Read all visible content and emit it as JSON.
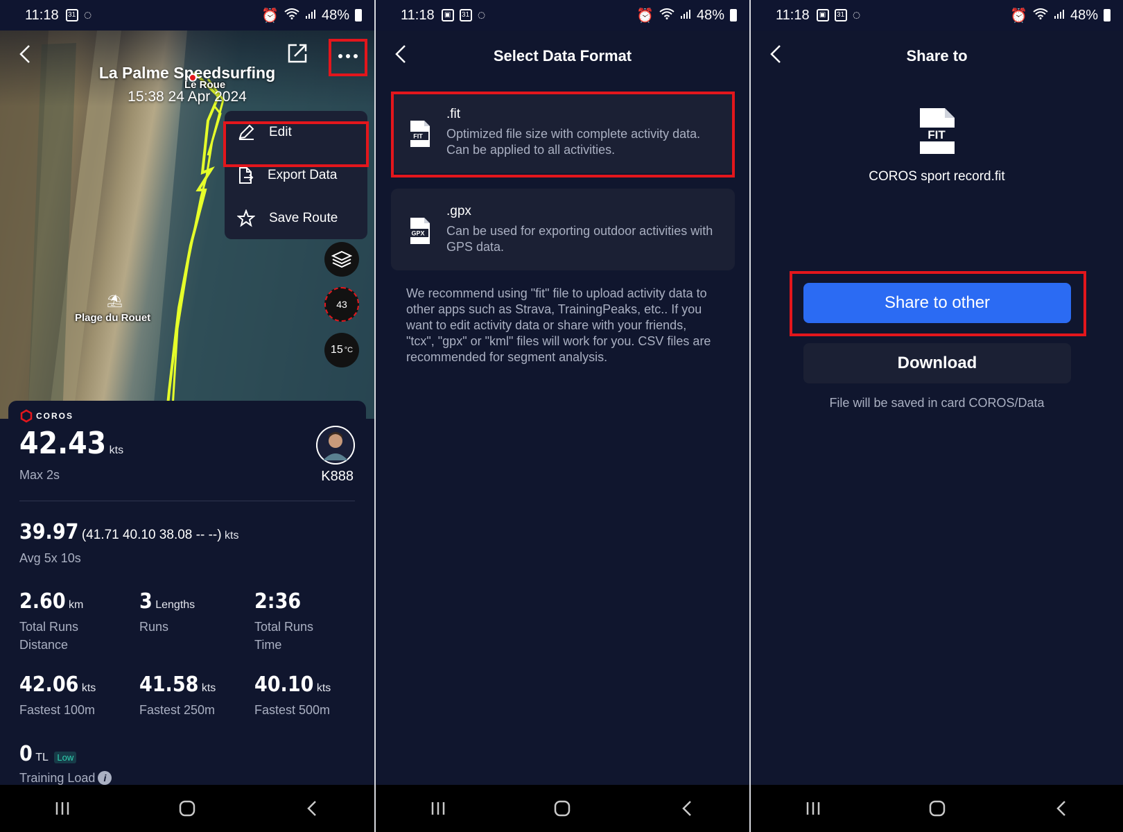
{
  "status_bar": {
    "time": "11:18",
    "battery": "48%"
  },
  "activity_screen": {
    "title": "La Palme Speedsurfing",
    "date": "15:38 24 Apr 2024",
    "map_labels": {
      "place_top": "Le Roue",
      "place_beach": "Plage du Rouet"
    },
    "controls": {
      "view_mode": "2D",
      "compass_value": "43",
      "temperature_value": "15",
      "temperature_unit": "°C"
    },
    "menu": {
      "edit": "Edit",
      "export": "Export Data",
      "save_route": "Save Route"
    },
    "brand": "COROS",
    "max_speed": {
      "value": "42.43",
      "unit": "kts",
      "label": "Max 2s"
    },
    "user": {
      "name": "K888"
    },
    "avg": {
      "value": "39.97",
      "detail": "(41.71 40.10 38.08 -- --)",
      "unit": "kts",
      "label": "Avg 5x 10s"
    },
    "metrics_row1": [
      {
        "value": "2.60",
        "unit": "km",
        "label": "Total Runs Distance"
      },
      {
        "value": "3",
        "unit": "Lengths",
        "label": "Runs"
      },
      {
        "value": "2:36",
        "unit": "",
        "label": "Total Runs Time"
      }
    ],
    "metrics_row2": [
      {
        "value": "42.06",
        "unit": "kts",
        "label": "Fastest 100m"
      },
      {
        "value": "41.58",
        "unit": "kts",
        "label": "Fastest 250m"
      },
      {
        "value": "40.10",
        "unit": "kts",
        "label": "Fastest 500m"
      }
    ],
    "training_load": {
      "value": "0",
      "unit": "TL",
      "badge": "Low",
      "label": "Training Load"
    }
  },
  "format_screen": {
    "title": "Select Data Format",
    "formats": [
      {
        "icon_text": "FIT",
        "name": ".fit",
        "description": "Optimized file size with complete activity data. Can be applied to all activities."
      },
      {
        "icon_text": "GPX",
        "name": ".gpx",
        "description": "Can be used for exporting outdoor activities with GPS data."
      }
    ],
    "recommendation": "We recommend using \"fit\" file to upload activity data to other apps such as Strava, TrainingPeaks, etc.. If you want to edit activity data or share with your friends, \"tcx\", \"gpx\" or \"kml\" files will work for you. CSV files are recommended for segment analysis."
  },
  "share_screen": {
    "title": "Share to",
    "file_icon_text": "FIT",
    "file_name": "COROS sport record.fit",
    "share_button": "Share to other",
    "download_button": "Download",
    "note": "File will be saved in card COROS/Data"
  },
  "colors": {
    "accent_blue": "#2b6bf3",
    "highlight_red": "#e3161c",
    "track_yellow": "#e6ff2a",
    "card_bg": "#1b2034",
    "panel_bg": "#10162e"
  }
}
